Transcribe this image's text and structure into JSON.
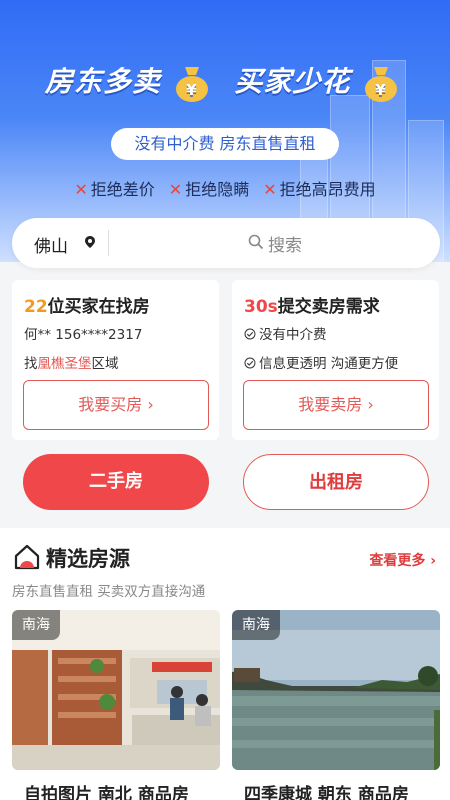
{
  "banner": {
    "slogan_left": "房东多卖",
    "slogan_right": "买家少花",
    "bag_symbol": "¥",
    "subtitle": "没有中介费  房东直售直租",
    "rejects": [
      "拒绝差价",
      "拒绝隐瞒",
      "拒绝高昂费用"
    ]
  },
  "search": {
    "city": "佛山",
    "placeholder": "搜索"
  },
  "buyer_card": {
    "count": "22",
    "headline_rest": "位买家在找房",
    "contact": "何** 156****2317",
    "area_prefix": "找",
    "area_name": "凰樵圣堡",
    "area_suffix": "区域",
    "cta": "我要买房 ›"
  },
  "seller_card": {
    "time": "30s",
    "headline_rest": "提交卖房需求",
    "points": [
      "没有中介费",
      "信息更透明 沟通更方便"
    ],
    "cta": "我要卖房 ›"
  },
  "buttons": {
    "second_hand": "二手房",
    "rental": "出租房"
  },
  "featured": {
    "title": "精选房源",
    "more": "查看更多 ›",
    "subtitle": "房东直售直租 买卖双方直接沟通",
    "listings": [
      {
        "district": "南海",
        "title": "自拍图片 南北 商品房"
      },
      {
        "district": "南海",
        "title": "四季康城 朝东 商品房"
      }
    ]
  },
  "colors": {
    "accent": "#f0474a",
    "brand_blue": "#2f6cf5",
    "orange": "#f39a1e"
  }
}
